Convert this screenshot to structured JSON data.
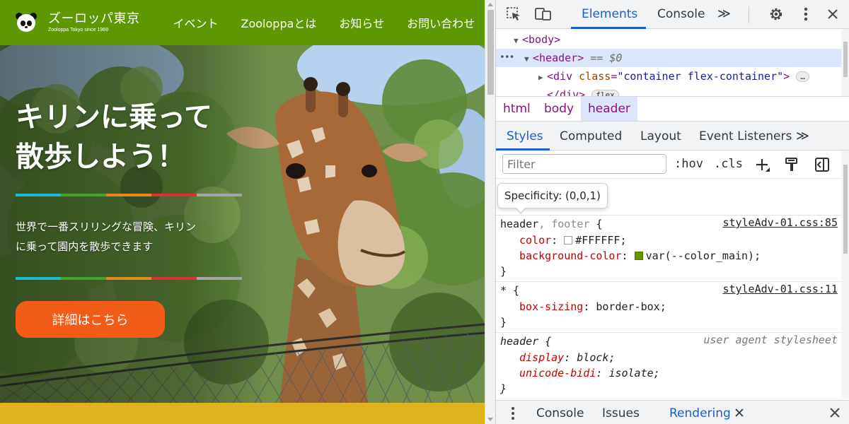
{
  "site": {
    "logo": {
      "title": "ズーロッパ東京",
      "subtitle": "Zooloppa Tokyo since 1969"
    },
    "nav": [
      "イベント",
      "Zooloppaとは",
      "お知らせ",
      "お問い合わせ"
    ],
    "hero": {
      "title_line1": "キリンに乗って",
      "title_line2": "散歩しよう！",
      "desc_line1": "世界で一番スリリングな冒険、キリン",
      "desc_line2": "に乗って園内を散歩できます",
      "cta": "詳細はこちら"
    },
    "colors": {
      "header": "#5f9700",
      "cta": "#f25c19",
      "footer": "#e0b21e"
    }
  },
  "devtools": {
    "toolbar": {
      "tabs": [
        "Elements",
        "Console"
      ],
      "active_tab": "Elements",
      "more": "≫",
      "icons": [
        "inspect-icon",
        "device-toolbar-icon",
        "settings-gear-icon",
        "kebab-menu-icon",
        "close-icon"
      ]
    },
    "dom": {
      "body_tag": "<body>",
      "header_tag": "<header>",
      "selected_marker": "== $0",
      "div_open": "<div ",
      "div_attr_name": "class",
      "div_attr_value": "\"container flex-container\"",
      "div_close": ">",
      "div_end": "</div>",
      "flex_badge": "flex",
      "ellipsis": "…",
      "row_menu": "•••"
    },
    "breadcrumbs": [
      "html",
      "body",
      "header"
    ],
    "subtabs": [
      "Styles",
      "Computed",
      "Layout",
      "Event Listeners"
    ],
    "filter": {
      "placeholder": "Filter",
      "hov": ":hov",
      "cls": ".cls"
    },
    "tooltip": "Specificity: (0,0,1)",
    "rules": {
      "r1": {
        "selector_main": "header",
        "selector_dim": ", footer",
        "source": "styleAdv-01.css:85",
        "p1_name": "color",
        "p1_value": "#FFFFFF",
        "p2_name": "background-color",
        "p2_value": "var(--color_main)"
      },
      "r2": {
        "selector_main": "*",
        "source": "styleAdv-01.css:11",
        "p1_name": "box-sizing",
        "p1_value": "border-box"
      },
      "r3": {
        "selector_main": "header",
        "source": "user agent stylesheet",
        "p1_name": "display",
        "p1_value": "block",
        "p2_name": "unicode-bidi",
        "p2_value": "isolate"
      }
    },
    "drawer": {
      "tabs": [
        "Console",
        "Issues",
        "Rendering"
      ],
      "active_tab": "Rendering"
    }
  }
}
